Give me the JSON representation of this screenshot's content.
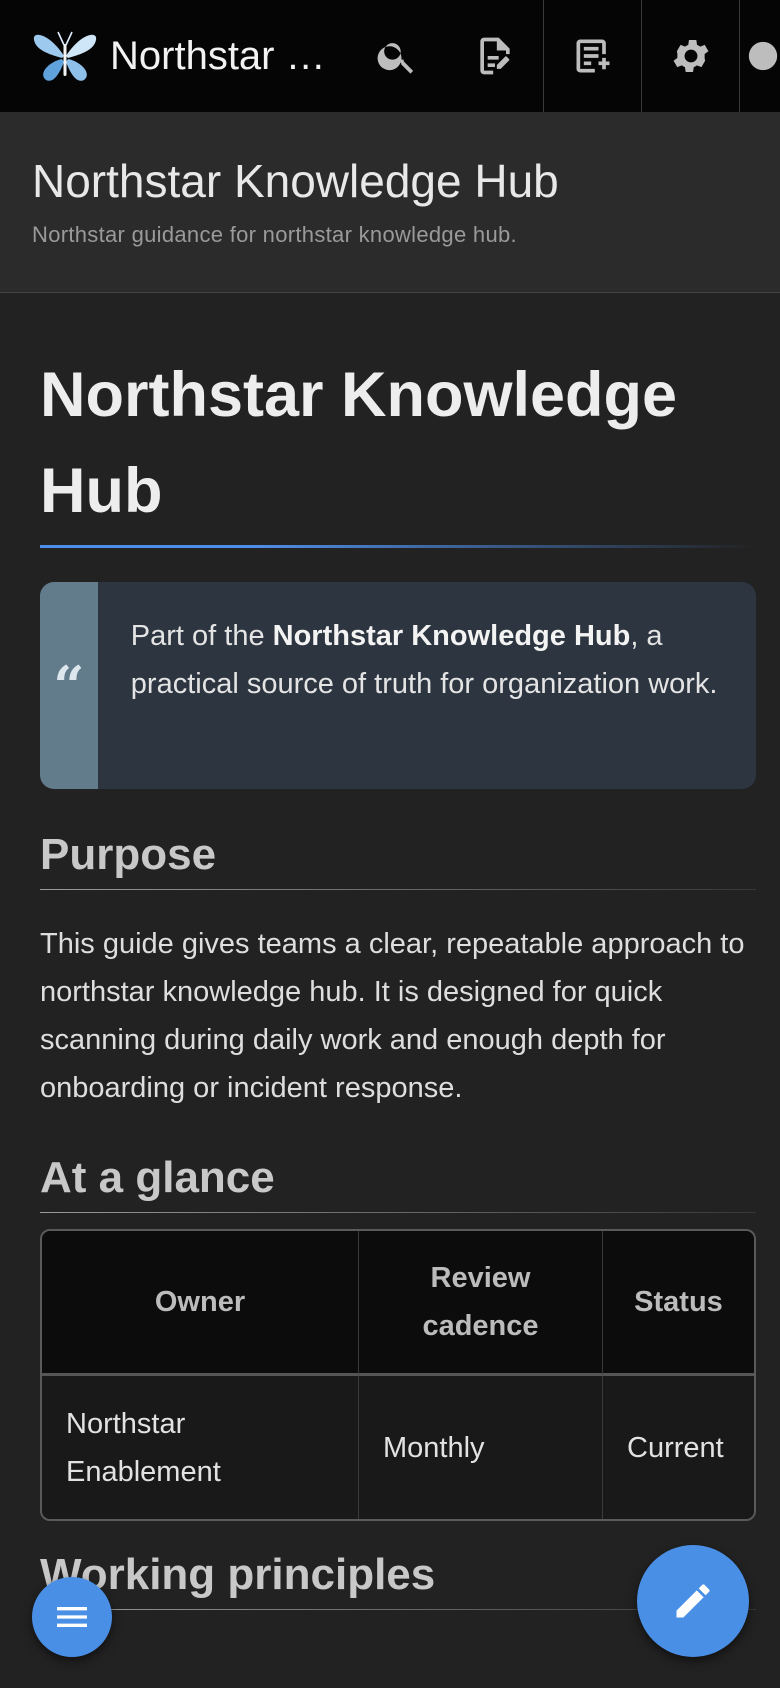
{
  "topbar": {
    "brand_title": "Northstar Knowledge Hub",
    "icons": [
      "butterfly-logo",
      "search-icon",
      "edit-document-icon",
      "new-page-icon",
      "gear-icon",
      "account-icon"
    ]
  },
  "site_header": {
    "title": "Northstar Knowledge Hub",
    "subtitle": "Northstar guidance for northstar knowledge hub."
  },
  "page": {
    "title": "Northstar Knowledge Hub",
    "callout": {
      "prefix": "Part of the ",
      "bold": "Northstar Knowledge Hub",
      "suffix": ", a practical source of truth for organization work."
    },
    "purpose": {
      "heading": "Purpose",
      "body": "This guide gives teams a clear, repeatable approach to northstar knowledge hub. It is designed for quick scanning during daily work and enough depth for onboarding or incident response."
    },
    "glance": {
      "heading": "At a glance",
      "headers": [
        "Owner",
        "Review cadence",
        "Status"
      ],
      "row": [
        "Northstar Enablement",
        "Monthly",
        "Current"
      ]
    },
    "working_principles_heading": "Working principles"
  },
  "colors": {
    "accent": "#4a8fe6",
    "background": "#222222",
    "topbar": "#050505"
  }
}
